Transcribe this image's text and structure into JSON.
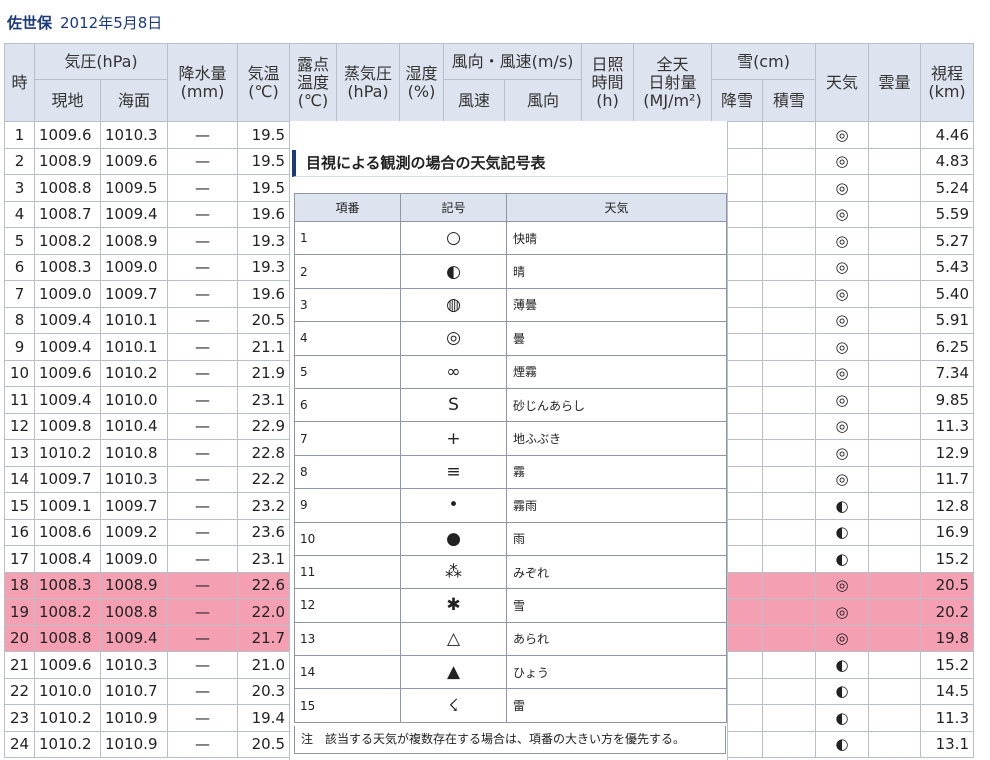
{
  "title": {
    "place": "佐世保",
    "date": "2012年5月8日"
  },
  "headers": {
    "hour": "時",
    "pressure": "気圧(hPa)",
    "pressure_station": "現地",
    "pressure_sea": "海面",
    "precip": "降水量\n(mm)",
    "temp": "気温\n(℃)",
    "dew": "露点\n温度\n(℃)",
    "vapor": "蒸気圧\n(hPa)",
    "humidity": "湿度\n(%)",
    "wind": "風向・風速(m/s)",
    "wind_speed": "風速",
    "wind_dir": "風向",
    "sunshine": "日照\n時間\n(h)",
    "radiation": "全天\n日射量\n(MJ/m²)",
    "snow": "雪(cm)",
    "snowfall": "降雪",
    "snow_depth": "積雪",
    "weather": "天気",
    "cloud": "雲量",
    "visibility": "視程\n(km)"
  },
  "rows": [
    {
      "hour": "1",
      "station": "1009.6",
      "sea": "1010.3",
      "precip": "—",
      "temp": "19.5",
      "weather": "◎",
      "visibility": "4.46",
      "highlight": false
    },
    {
      "hour": "2",
      "station": "1008.9",
      "sea": "1009.6",
      "precip": "—",
      "temp": "19.5",
      "weather": "◎",
      "visibility": "4.83",
      "highlight": false
    },
    {
      "hour": "3",
      "station": "1008.8",
      "sea": "1009.5",
      "precip": "—",
      "temp": "19.5",
      "weather": "◎",
      "visibility": "5.24",
      "highlight": false
    },
    {
      "hour": "4",
      "station": "1008.7",
      "sea": "1009.4",
      "precip": "—",
      "temp": "19.6",
      "weather": "◎",
      "visibility": "5.59",
      "highlight": false
    },
    {
      "hour": "5",
      "station": "1008.2",
      "sea": "1008.9",
      "precip": "—",
      "temp": "19.3",
      "weather": "◎",
      "visibility": "5.27",
      "highlight": false
    },
    {
      "hour": "6",
      "station": "1008.3",
      "sea": "1009.0",
      "precip": "—",
      "temp": "19.3",
      "weather": "◎",
      "visibility": "5.43",
      "highlight": false
    },
    {
      "hour": "7",
      "station": "1009.0",
      "sea": "1009.7",
      "precip": "—",
      "temp": "19.6",
      "weather": "◎",
      "visibility": "5.40",
      "highlight": false
    },
    {
      "hour": "8",
      "station": "1009.4",
      "sea": "1010.1",
      "precip": "—",
      "temp": "20.5",
      "weather": "◎",
      "visibility": "5.91",
      "highlight": false
    },
    {
      "hour": "9",
      "station": "1009.4",
      "sea": "1010.1",
      "precip": "—",
      "temp": "21.1",
      "weather": "◎",
      "visibility": "6.25",
      "highlight": false
    },
    {
      "hour": "10",
      "station": "1009.6",
      "sea": "1010.2",
      "precip": "—",
      "temp": "21.9",
      "weather": "◎",
      "visibility": "7.34",
      "highlight": false
    },
    {
      "hour": "11",
      "station": "1009.4",
      "sea": "1010.0",
      "precip": "—",
      "temp": "23.1",
      "weather": "◎",
      "visibility": "9.85",
      "highlight": false
    },
    {
      "hour": "12",
      "station": "1009.8",
      "sea": "1010.4",
      "precip": "—",
      "temp": "22.9",
      "weather": "◎",
      "visibility": "11.3",
      "highlight": false
    },
    {
      "hour": "13",
      "station": "1010.2",
      "sea": "1010.8",
      "precip": "—",
      "temp": "22.8",
      "weather": "◎",
      "visibility": "12.9",
      "highlight": false
    },
    {
      "hour": "14",
      "station": "1009.7",
      "sea": "1010.3",
      "precip": "—",
      "temp": "22.2",
      "weather": "◎",
      "visibility": "11.7",
      "highlight": false
    },
    {
      "hour": "15",
      "station": "1009.1",
      "sea": "1009.7",
      "precip": "—",
      "temp": "23.2",
      "weather": "◐",
      "visibility": "12.8",
      "highlight": false
    },
    {
      "hour": "16",
      "station": "1008.6",
      "sea": "1009.2",
      "precip": "—",
      "temp": "23.6",
      "weather": "◐",
      "visibility": "16.9",
      "highlight": false
    },
    {
      "hour": "17",
      "station": "1008.4",
      "sea": "1009.0",
      "precip": "—",
      "temp": "23.1",
      "weather": "◐",
      "visibility": "15.2",
      "highlight": false
    },
    {
      "hour": "18",
      "station": "1008.3",
      "sea": "1008.9",
      "precip": "—",
      "temp": "22.6",
      "weather": "◎",
      "visibility": "20.5",
      "highlight": true
    },
    {
      "hour": "19",
      "station": "1008.2",
      "sea": "1008.8",
      "precip": "—",
      "temp": "22.0",
      "weather": "◎",
      "visibility": "20.2",
      "highlight": true
    },
    {
      "hour": "20",
      "station": "1008.8",
      "sea": "1009.4",
      "precip": "—",
      "temp": "21.7",
      "weather": "◎",
      "visibility": "19.8",
      "highlight": true
    },
    {
      "hour": "21",
      "station": "1009.6",
      "sea": "1010.3",
      "precip": "—",
      "temp": "21.0",
      "weather": "◐",
      "visibility": "15.2",
      "highlight": false
    },
    {
      "hour": "22",
      "station": "1010.0",
      "sea": "1010.7",
      "precip": "—",
      "temp": "20.3",
      "weather": "◐",
      "visibility": "14.5",
      "highlight": false
    },
    {
      "hour": "23",
      "station": "1010.2",
      "sea": "1010.9",
      "precip": "—",
      "temp": "19.4",
      "weather": "◐",
      "visibility": "11.3",
      "highlight": false
    },
    {
      "hour": "24",
      "station": "1010.2",
      "sea": "1010.9",
      "precip": "—",
      "temp": "20.5",
      "weather": "◐",
      "visibility": "13.1",
      "highlight": false
    }
  ],
  "legend": {
    "title": "目視による観測の場合の天気記号表",
    "col_number": "項番",
    "col_symbol": "記号",
    "col_weather": "天気",
    "items": [
      {
        "no": "1",
        "symbol": "○",
        "weather": "快晴"
      },
      {
        "no": "2",
        "symbol": "◐",
        "weather": "晴"
      },
      {
        "no": "3",
        "symbol": "◍",
        "weather": "薄曇"
      },
      {
        "no": "4",
        "symbol": "◎",
        "weather": "曇"
      },
      {
        "no": "5",
        "symbol": "∞",
        "weather": "煙霧"
      },
      {
        "no": "6",
        "symbol": "S",
        "weather": "砂じんあらし"
      },
      {
        "no": "7",
        "symbol": "+",
        "weather": "地ふぶき"
      },
      {
        "no": "8",
        "symbol": "≡",
        "weather": "霧"
      },
      {
        "no": "9",
        "symbol": "•",
        "weather": "霧雨"
      },
      {
        "no": "10",
        "symbol": "●",
        "weather": "雨"
      },
      {
        "no": "11",
        "symbol": "⁂",
        "weather": "みぞれ"
      },
      {
        "no": "12",
        "symbol": "✱",
        "weather": "雪"
      },
      {
        "no": "13",
        "symbol": "△",
        "weather": "あられ"
      },
      {
        "no": "14",
        "symbol": "▲",
        "weather": "ひょう"
      },
      {
        "no": "15",
        "symbol": "☇",
        "weather": "雷"
      }
    ],
    "note": "注　該当する天気が複数存在する場合は、項番の大きい方を優先する。"
  },
  "colors": {
    "header_bg": "#dde3ef",
    "highlight": "#f59fb3",
    "border": "#b9bfc9",
    "title": "#1b3a7a"
  }
}
